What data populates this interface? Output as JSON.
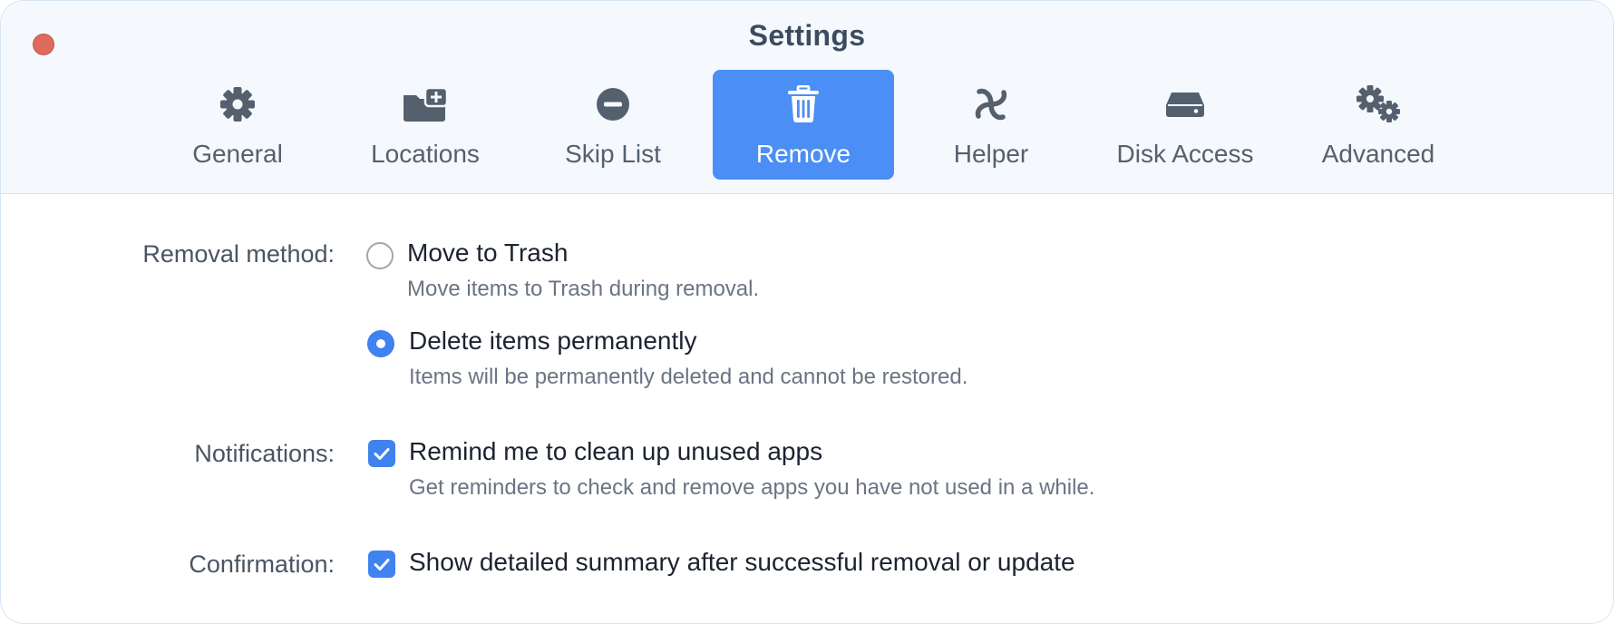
{
  "window": {
    "title": "Settings"
  },
  "toolbar": {
    "tabs": [
      {
        "id": "general",
        "label": "General",
        "icon": "gear-icon"
      },
      {
        "id": "locations",
        "label": "Locations",
        "icon": "folder-plus-icon"
      },
      {
        "id": "skip-list",
        "label": "Skip List",
        "icon": "minus-circle-icon"
      },
      {
        "id": "remove",
        "label": "Remove",
        "icon": "trash-icon",
        "active": true
      },
      {
        "id": "helper",
        "label": "Helper",
        "icon": "helper-swirl-icon"
      },
      {
        "id": "disk-access",
        "label": "Disk Access",
        "icon": "disk-drive-icon"
      },
      {
        "id": "advanced",
        "label": "Advanced",
        "icon": "gears-icon"
      }
    ]
  },
  "removal": {
    "label": "Removal method:",
    "options": [
      {
        "title": "Move to Trash",
        "description": "Move items to Trash during removal.",
        "selected": false
      },
      {
        "title": "Delete items permanently",
        "description": "Items will be permanently deleted and cannot be restored.",
        "selected": true
      }
    ]
  },
  "notifications": {
    "label": "Notifications:",
    "title": "Remind me to clean up unused apps",
    "description": "Get reminders to check and remove apps you have not used in a while.",
    "checked": true
  },
  "confirmation": {
    "label": "Confirmation:",
    "title": "Show detailed summary after successful removal or update",
    "checked": true
  },
  "colors": {
    "accent": "#4b8ef5",
    "close": "#de6b5c",
    "titlebar_bg": "#f5f9fe"
  }
}
